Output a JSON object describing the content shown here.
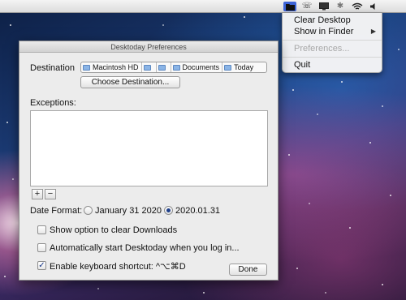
{
  "menubar": {
    "icons": [
      "folder-icon",
      "phone-icon",
      "display-icon",
      "bluetooth-icon",
      "wifi-icon",
      "volume-icon"
    ]
  },
  "menu": {
    "items": [
      {
        "label": "Clear Desktop",
        "enabled": true
      },
      {
        "label": "Show in Finder",
        "enabled": true,
        "submenu": true
      },
      {
        "label": "Preferences...",
        "enabled": false
      },
      {
        "label": "Quit",
        "enabled": true
      }
    ]
  },
  "window": {
    "title": "Desktoday Preferences",
    "destination_label": "Destination",
    "path": [
      "Macintosh HD",
      "",
      "",
      "Documents",
      "Today"
    ],
    "choose_destination_label": "Choose Destination...",
    "exceptions_label": "Exceptions:",
    "exceptions": [],
    "add_label": "+",
    "remove_label": "−",
    "date_format_label": "Date Format:",
    "date_formats": [
      {
        "label": "January 31 2020",
        "selected": false
      },
      {
        "label": "2020.01.31",
        "selected": true
      }
    ],
    "options": [
      {
        "label": "Show option to clear Downloads",
        "checked": false
      },
      {
        "label": "Automatically start Desktoday when you log in...",
        "checked": false
      },
      {
        "label": "Enable keyboard shortcut: ^⌥⌘D",
        "checked": true
      }
    ],
    "done_label": "Done"
  },
  "colors": {
    "menu_highlight": "#3d64d8",
    "radio_dot": "#1e3f8a"
  }
}
